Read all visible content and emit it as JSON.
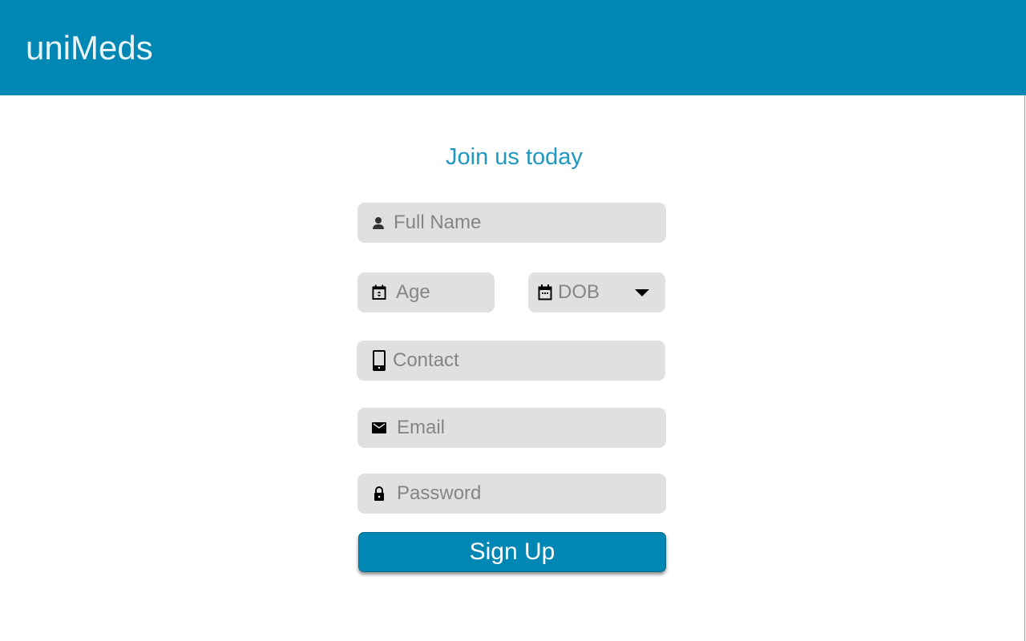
{
  "header": {
    "brand": "uniMeds"
  },
  "form": {
    "title": "Join us today",
    "full_name": {
      "placeholder": "Full Name",
      "icon": "person-icon"
    },
    "age": {
      "placeholder": "Age",
      "icon": "calendar-stepper-icon"
    },
    "dob": {
      "selected": "DOB",
      "icon": "calendar-icon"
    },
    "contact": {
      "placeholder": "Contact",
      "icon": "phone-icon"
    },
    "email": {
      "placeholder": "Email",
      "icon": "mail-icon"
    },
    "password": {
      "placeholder": "Password",
      "icon": "lock-icon"
    },
    "submit_label": "Sign Up"
  },
  "colors": {
    "brand": "#0087b4",
    "title": "#1f98c0",
    "field_bg": "#e0e0e0"
  }
}
